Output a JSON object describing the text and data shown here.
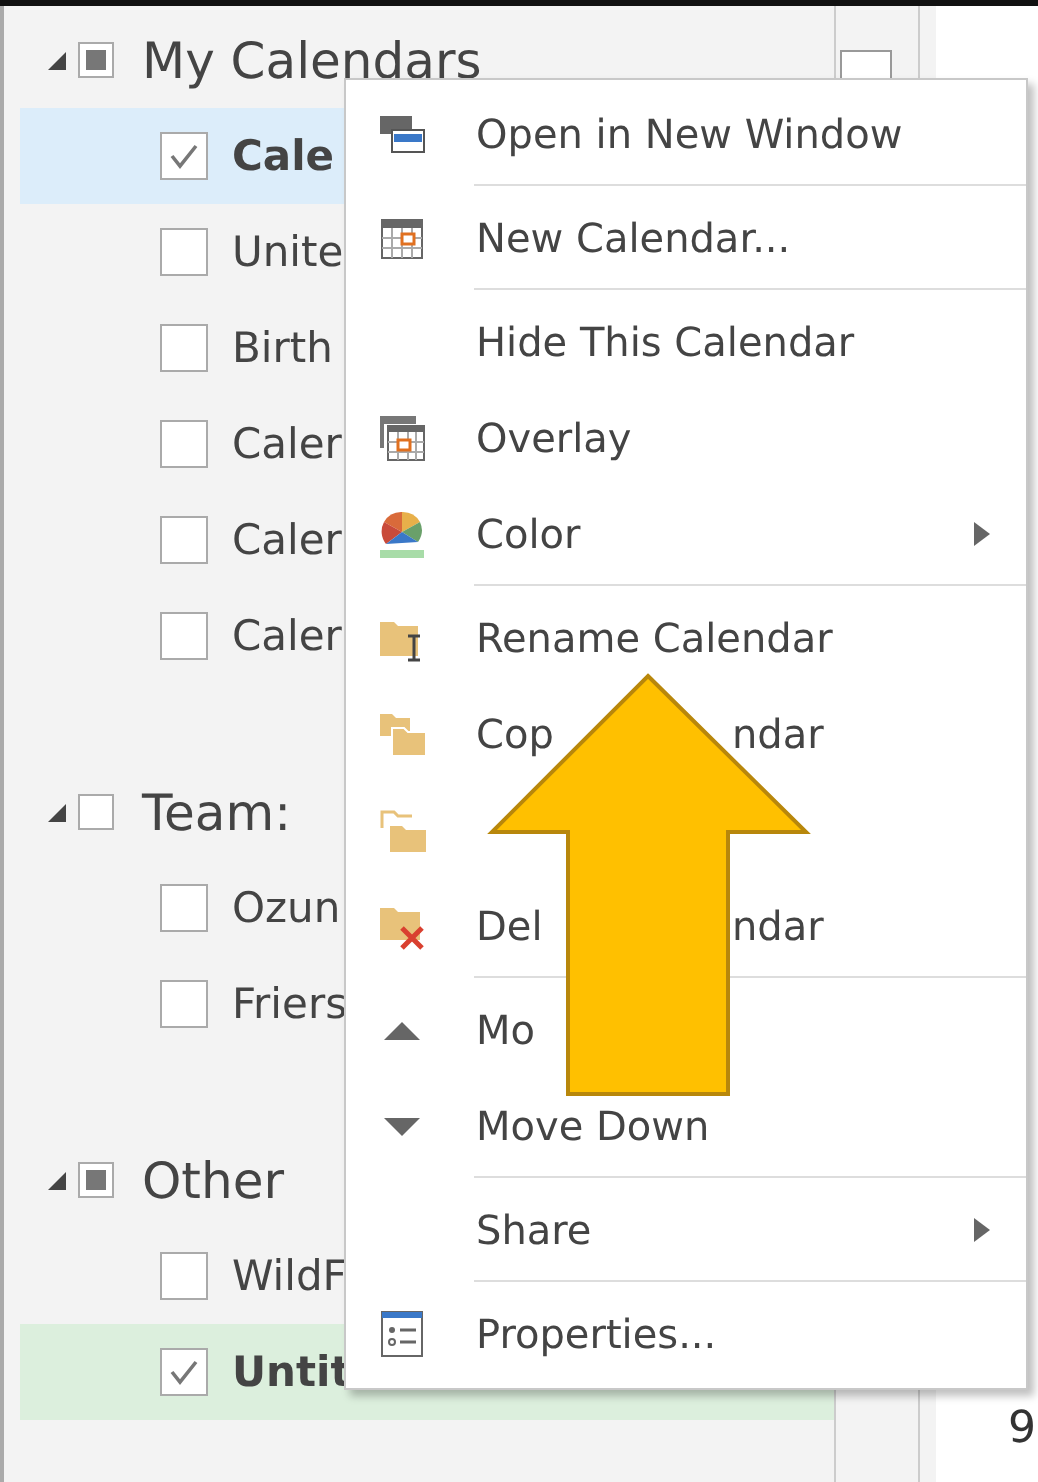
{
  "sidebar": {
    "groups": [
      {
        "name": "My Calendars",
        "expanded": true,
        "partial": true,
        "items": [
          {
            "name": "Cale",
            "checked": true,
            "selected": true
          },
          {
            "name": "Unite",
            "checked": false,
            "selected": false
          },
          {
            "name": "Birth",
            "checked": false,
            "selected": false
          },
          {
            "name": "Caler",
            "checked": false,
            "selected": false
          },
          {
            "name": "Caler",
            "checked": false,
            "selected": false
          },
          {
            "name": "Caler",
            "checked": false,
            "selected": false
          }
        ]
      },
      {
        "name": "Team:",
        "expanded": true,
        "partial": false,
        "items": [
          {
            "name": "Ozun",
            "checked": false,
            "selected": false
          },
          {
            "name": "Friers",
            "checked": false,
            "selected": false
          }
        ]
      },
      {
        "name": "Other",
        "expanded": true,
        "partial": true,
        "items": [
          {
            "name": "WildF",
            "checked": false,
            "selected": false
          },
          {
            "name": "Untit",
            "checked": true,
            "selected": false,
            "color": "#dcefdd"
          }
        ]
      }
    ]
  },
  "calendar_peek": {
    "text": "9"
  },
  "context_menu": {
    "items": [
      {
        "kind": "window",
        "parts": [
          "Open in New Window"
        ],
        "submenu": false,
        "divider_after": true
      },
      {
        "kind": "calendar",
        "parts": [
          "New Calendar..."
        ],
        "submenu": false,
        "divider_after": true
      },
      {
        "kind": "plain",
        "parts": [
          "Hide This Calendar"
        ],
        "submenu": false,
        "divider_after": false
      },
      {
        "kind": "overlay",
        "parts": [
          "Overlay"
        ],
        "submenu": false,
        "divider_after": false
      },
      {
        "kind": "palette",
        "parts": [
          "Color"
        ],
        "submenu": true,
        "divider_after": true
      },
      {
        "kind": "rename",
        "parts": [
          "Rename Calendar"
        ],
        "submenu": false,
        "divider_after": false
      },
      {
        "kind": "copy",
        "parts": [
          "Cop",
          "ndar"
        ],
        "submenu": false,
        "divider_after": false
      },
      {
        "kind": "move",
        "submenu": false,
        "divider_after": false
      },
      {
        "kind": "delete",
        "parts": [
          "Del",
          "ndar"
        ],
        "submenu": false,
        "divider_after": true
      },
      {
        "kind": "up",
        "parts": [
          "Mo"
        ],
        "submenu": false,
        "divider_after": false
      },
      {
        "kind": "down",
        "parts": [
          "Move Down"
        ],
        "submenu": false,
        "divider_after": true
      },
      {
        "kind": "plain",
        "parts": [
          "Share"
        ],
        "submenu": true,
        "divider_after": true
      },
      {
        "kind": "properties",
        "parts": [
          "Properties..."
        ],
        "submenu": false,
        "divider_after": false
      }
    ]
  }
}
